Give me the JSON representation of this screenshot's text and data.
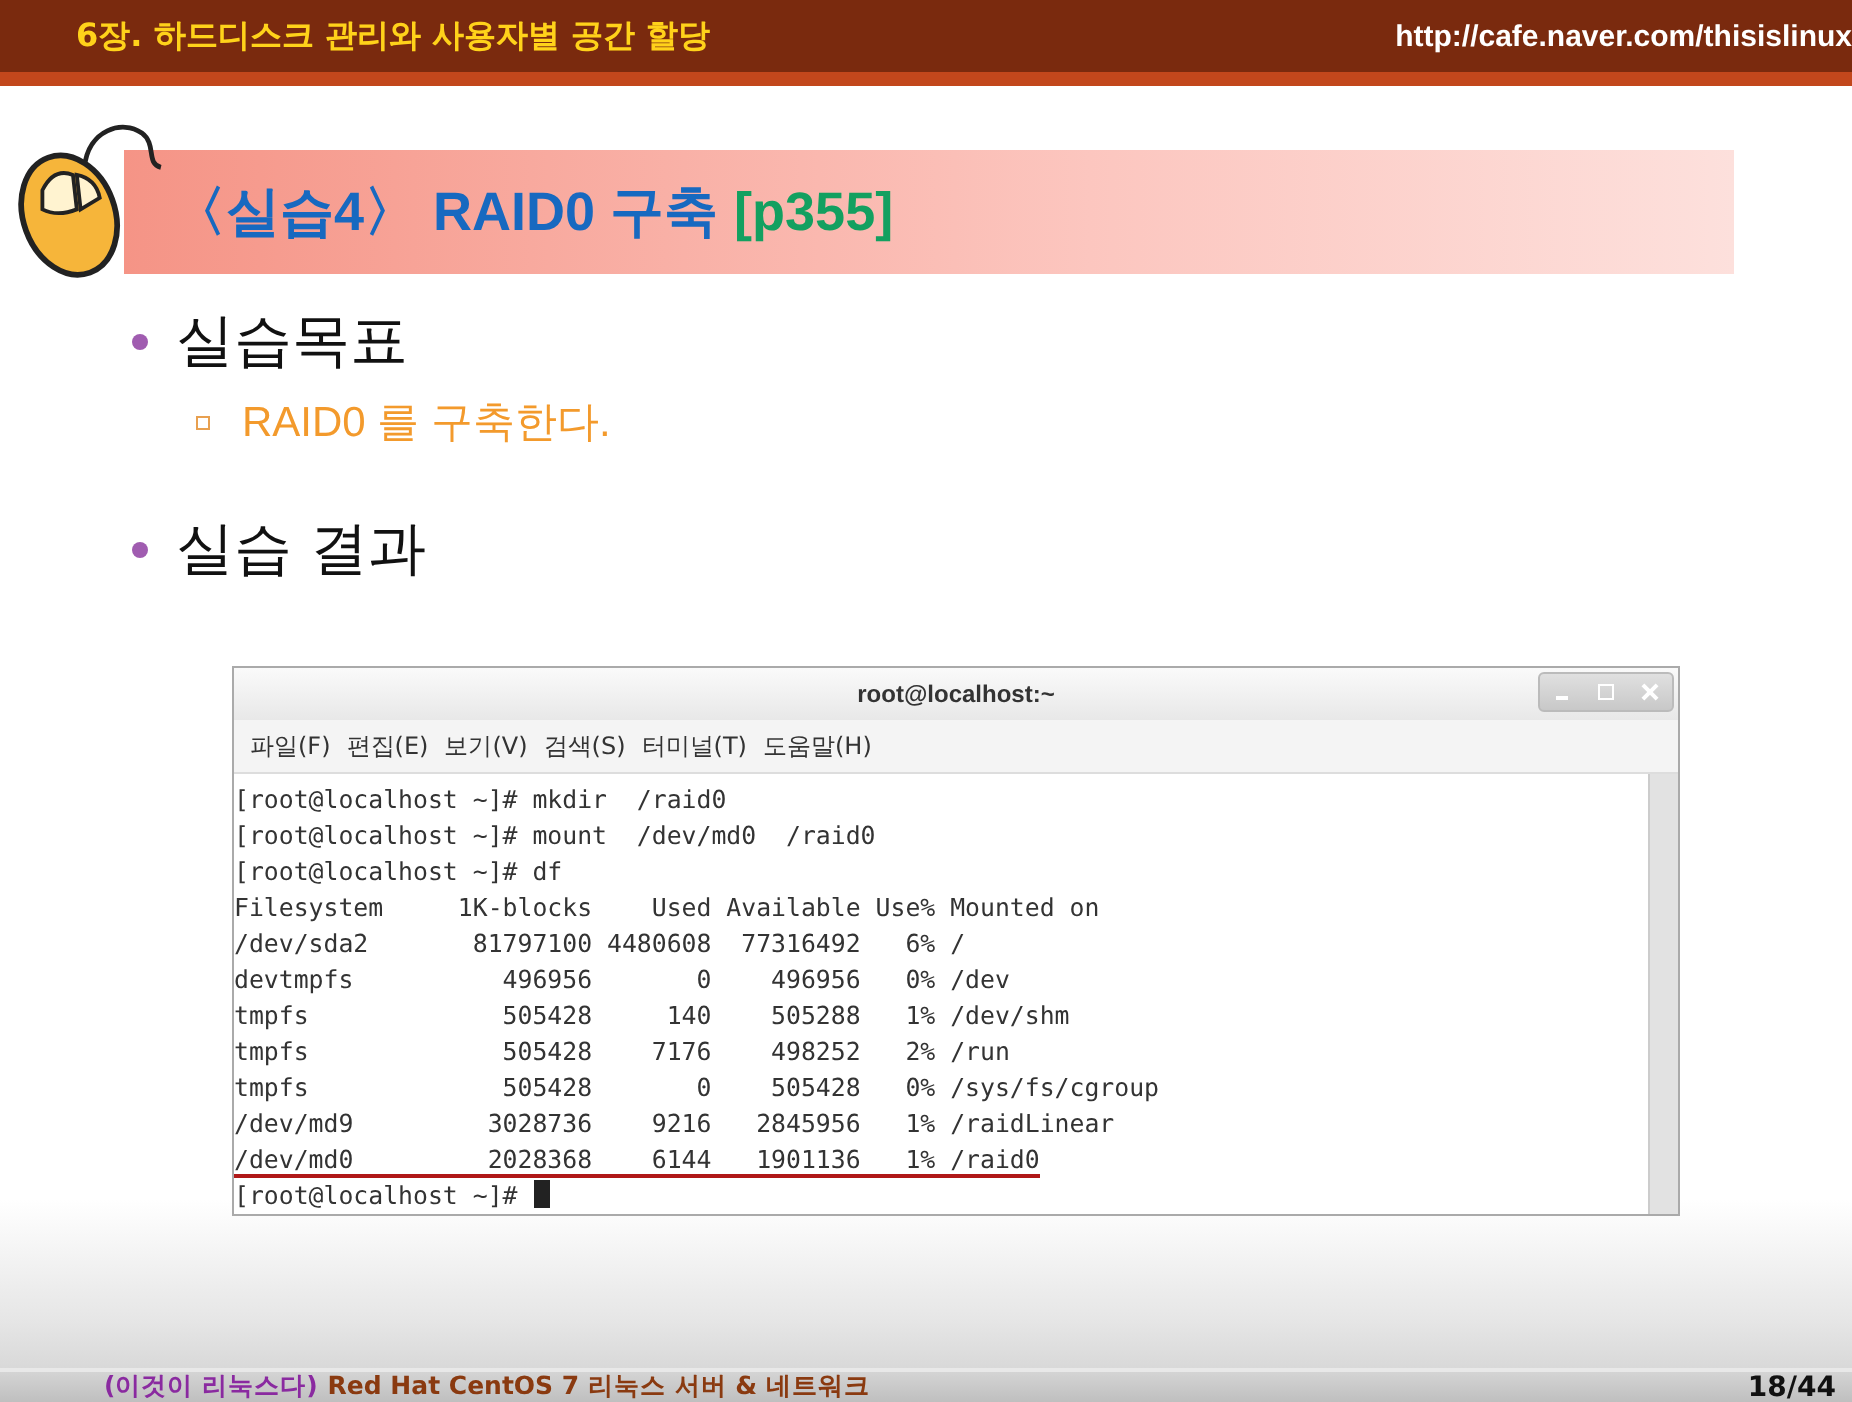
{
  "header": {
    "title": "6장. 하드디스크 관리와 사용자별 공간 할당",
    "url": "http://cafe.naver.com/thisislinux"
  },
  "heading": {
    "label": "〈실습4〉 RAID0 구축",
    "page_ref": "[p355]"
  },
  "bullets": [
    {
      "text": "실습목표",
      "children": [
        {
          "text": "RAID0 를 구축한다."
        }
      ]
    },
    {
      "text": "실습 결과"
    }
  ],
  "terminal": {
    "title": "root@localhost:~",
    "menu": [
      "파일(F)",
      "편집(E)",
      "보기(V)",
      "검색(S)",
      "터미널(T)",
      "도움말(H)"
    ],
    "lines": [
      {
        "text": "[root@localhost ~]# mkdir  /raid0",
        "underlined": false,
        "cursor": false
      },
      {
        "text": "[root@localhost ~]# mount  /dev/md0  /raid0",
        "underlined": false,
        "cursor": false
      },
      {
        "text": "[root@localhost ~]# df",
        "underlined": false,
        "cursor": false
      },
      {
        "text": "Filesystem     1K-blocks    Used Available Use% Mounted on",
        "underlined": false,
        "cursor": false
      },
      {
        "text": "/dev/sda2       81797100 4480608  77316492   6% /",
        "underlined": false,
        "cursor": false
      },
      {
        "text": "devtmpfs          496956       0    496956   0% /dev",
        "underlined": false,
        "cursor": false
      },
      {
        "text": "tmpfs             505428     140    505288   1% /dev/shm",
        "underlined": false,
        "cursor": false
      },
      {
        "text": "tmpfs             505428    7176    498252   2% /run",
        "underlined": false,
        "cursor": false
      },
      {
        "text": "tmpfs             505428       0    505428   0% /sys/fs/cgroup",
        "underlined": false,
        "cursor": false
      },
      {
        "text": "/dev/md9         3028736    9216   2845956   1% /raidLinear",
        "underlined": false,
        "cursor": false
      },
      {
        "text": "/dev/md0         2028368    6144   1901136   1% /raid0",
        "underlined": true,
        "cursor": false
      },
      {
        "text": "[root@localhost ~]#",
        "underlined": false,
        "cursor": true
      }
    ]
  },
  "footer": {
    "book": "(이것이 리눅스다)",
    "subtitle": "Red Hat CentOS 7 리눅스 서버 & 네트워크",
    "page": "18/44"
  }
}
